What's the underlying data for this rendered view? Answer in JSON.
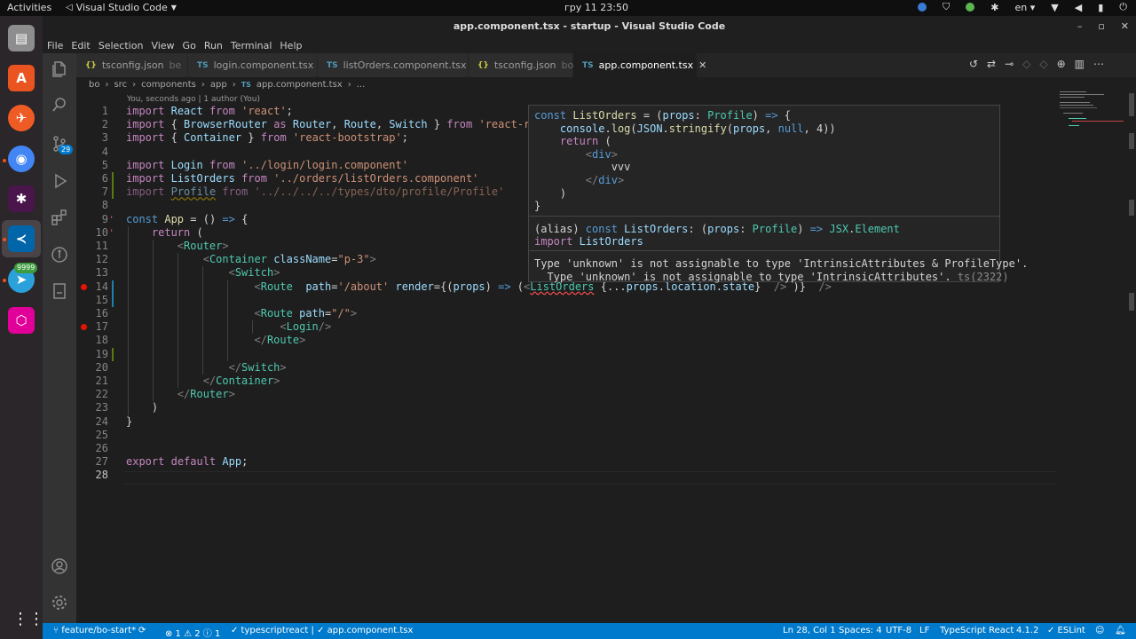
{
  "system": {
    "activities": "Activities",
    "app_name": "Visual Studio Code",
    "clock": "гру 11  23:50",
    "lang": "en"
  },
  "dock": {
    "telegram_badge": "9999"
  },
  "window": {
    "title": "app.component.tsx - startup - Visual Studio Code"
  },
  "menu": [
    "File",
    "Edit",
    "Selection",
    "View",
    "Go",
    "Run",
    "Terminal",
    "Help"
  ],
  "activity": {
    "scm_badge": "29"
  },
  "tabs": [
    {
      "icon": "{}",
      "label": "tsconfig.json",
      "hint": "be",
      "active": false,
      "icon_color": "#cbcb41"
    },
    {
      "icon": "TS",
      "label": "login.component.tsx",
      "hint": "",
      "active": false,
      "icon_color": "#519aba"
    },
    {
      "icon": "TS",
      "label": "listOrders.component.tsx",
      "hint": "",
      "active": false,
      "icon_color": "#519aba"
    },
    {
      "icon": "{}",
      "label": "tsconfig.json",
      "hint": "bo",
      "active": false,
      "icon_color": "#cbcb41"
    },
    {
      "icon": "TS",
      "label": "app.component.tsx",
      "hint": "",
      "active": true,
      "icon_color": "#519aba"
    }
  ],
  "breadcrumb": [
    "bo",
    "src",
    "components",
    "app",
    "app.component.tsx",
    "..."
  ],
  "codelens": "You, seconds ago | 1 author (You)",
  "code": [
    {
      "n": "1",
      "html": "<span class='kw'>import</span> <span class='var'>React</span> <span class='kw'>from</span> <span class='str'>'react'</span>;"
    },
    {
      "n": "2",
      "html": "<span class='kw'>import</span> { <span class='var'>BrowserRouter</span> <span class='kw'>as</span> <span class='var'>Router</span>, <span class='var'>Route</span>, <span class='var'>Switch</span> } <span class='kw'>from</span> <span class='str'>'react-route</span>"
    },
    {
      "n": "3",
      "html": "<span class='kw'>import</span> { <span class='var'>Container</span> } <span class='kw'>from</span> <span class='str'>'react-bootstrap'</span>;"
    },
    {
      "n": "4",
      "html": ""
    },
    {
      "n": "5",
      "html": "<span class='kw'>import</span> <span class='var'>Login</span> <span class='kw'>from</span> <span class='str'>'../login/login.component'</span>"
    },
    {
      "n": "6",
      "html": "<span class='kw'>import</span> <span class='var'>ListOrders</span> <span class='kw'>from</span> <span class='str'>'../orders/listOrders.component'</span>"
    },
    {
      "n": "7",
      "html": "<span class='dim'><span class='kw'>import</span> <span class='var' style='text-decoration: underline wavy #cca700;'>Profile</span> <span class='kw'>from</span> <span class='str'>'../../../../types/dto/profile/Profile'</span></span>"
    },
    {
      "n": "8",
      "html": ""
    },
    {
      "n": "9",
      "html": "<span class='kb'>const</span> <span class='fn'>App</span> = () <span class='kb'>=&gt;</span> {"
    },
    {
      "n": "10",
      "html": "    <span class='kw'>return</span> ("
    },
    {
      "n": "11",
      "html": "        <span class='pun'>&lt;</span><span class='tag'>Router</span><span class='pun'>&gt;</span>"
    },
    {
      "n": "12",
      "html": "            <span class='pun'>&lt;</span><span class='tag'>Container</span> <span class='var'>className</span>=<span class='str'>\"p-3\"</span><span class='pun'>&gt;</span>"
    },
    {
      "n": "13",
      "html": "                <span class='pun'>&lt;</span><span class='tag'>Switch</span><span class='pun'>&gt;</span>"
    },
    {
      "n": "14",
      "html": "                    <span class='pun'>&lt;</span><span class='tag'>Route</span>  <span class='var'>path</span>=<span class='str'>'/about'</span> <span class='var'>render</span>={(<span class='var'>props</span>) <span class='kb'>=&gt;</span> (<span class='pun'>&lt;</span><span class='tag' style='text-decoration: underline wavy #f14c4c;'>ListOrders</span> {...<span class='var'>props</span>.<span class='var'>location</span>.<span class='var'>state</span>}  <span class='pun'>/&gt;</span> )}  <span class='pun'>/&gt;</span>"
    },
    {
      "n": "15",
      "html": ""
    },
    {
      "n": "16",
      "html": "                    <span class='pun'>&lt;</span><span class='tag'>Route</span> <span class='var'>path</span>=<span class='str'>\"/\"</span><span class='pun'>&gt;</span>"
    },
    {
      "n": "17",
      "html": "                        <span class='pun'>&lt;</span><span class='tag'>Login</span><span class='pun'>/&gt;</span>"
    },
    {
      "n": "18",
      "html": "                    <span class='pun'>&lt;/</span><span class='tag'>Route</span><span class='pun'>&gt;</span>"
    },
    {
      "n": "19",
      "html": ""
    },
    {
      "n": "20",
      "html": "                <span class='pun'>&lt;/</span><span class='tag'>Switch</span><span class='pun'>&gt;</span>"
    },
    {
      "n": "21",
      "html": "            <span class='pun'>&lt;/</span><span class='tag'>Container</span><span class='pun'>&gt;</span>"
    },
    {
      "n": "22",
      "html": "        <span class='pun'>&lt;/</span><span class='tag'>Router</span><span class='pun'>&gt;</span>"
    },
    {
      "n": "23",
      "html": "    )"
    },
    {
      "n": "24",
      "html": "}"
    },
    {
      "n": "25",
      "html": ""
    },
    {
      "n": "26",
      "html": ""
    },
    {
      "n": "27",
      "html": "<span class='kw'>export</span> <span class='kw'>default</span> <span class='var'>App</span>;"
    },
    {
      "n": "28",
      "html": ""
    }
  ],
  "hover": {
    "source": [
      "<span class='kb'>const</span> <span class='fn'>ListOrders</span> = (<span class='var'>props</span>: <span class='cls'>Profile</span>) <span class='kb'>=&gt;</span> {",
      "    <span class='var'>console</span>.<span class='fn'>log</span>(<span class='var'>JSON</span>.<span class='fn'>stringify</span>(<span class='var'>props</span>, <span class='kb'>null</span>, 4))",
      "    <span class='kw'>return</span> (",
      "        <span class='pun'>&lt;</span><span class='kb'>div</span><span class='pun'>&gt;</span>",
      "            vvv",
      "        <span class='pun'>&lt;/</span><span class='kb'>div</span><span class='pun'>&gt;</span>",
      "    )",
      "}"
    ],
    "alias": [
      "(alias) <span class='kb'>const</span> <span class='var'>ListOrders</span>: (<span class='var'>props</span>: <span class='cls'>Profile</span>) <span class='kb'>=&gt;</span> <span class='cls'>JSX</span>.<span class='cls'>Element</span>",
      "<span class='kw'>import</span> <span class='var'>ListOrders</span>"
    ],
    "error1": "Type 'unknown' is not assignable to type 'IntrinsicAttributes & ProfileType'.",
    "error2": "  Type 'unknown' is not assignable to type 'IntrinsicAttributes'.",
    "error_code": "ts(2322)"
  },
  "status": {
    "branch": "feature/bo-start*",
    "problems": "⊗ 1 ⚠ 2 ⓘ 1",
    "lang_check": "✓ typescriptreact | ✓ app.component.tsx",
    "position": "Ln 28, Col 1",
    "spaces": "Spaces: 4",
    "encoding": "UTF-8",
    "eol": "LF",
    "language": "TypeScript React",
    "version": "4.1.2",
    "eslint": "✓ ESLint"
  }
}
